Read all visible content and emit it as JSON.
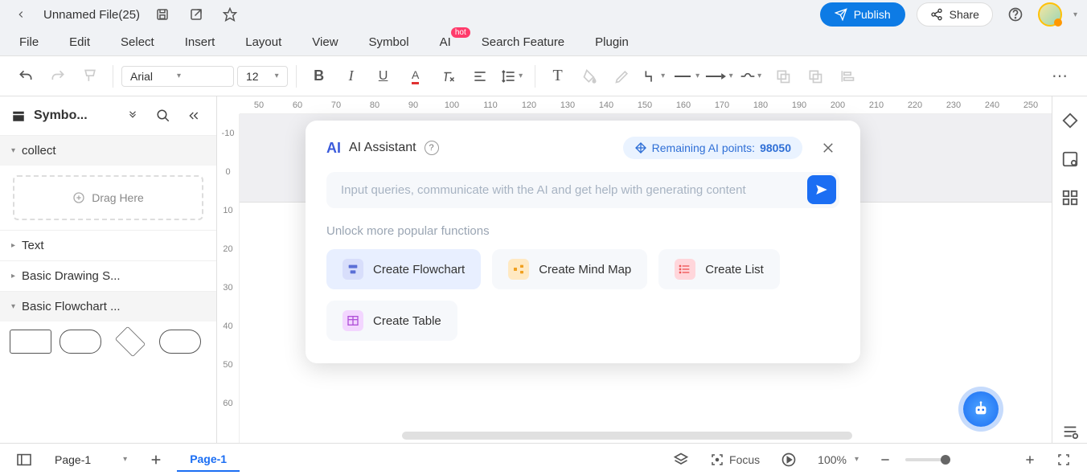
{
  "titlebar": {
    "filename": "Unnamed File(25)",
    "publish": "Publish",
    "share": "Share"
  },
  "menu": {
    "items": [
      "File",
      "Edit",
      "Select",
      "Insert",
      "Layout",
      "View",
      "Symbol",
      "AI",
      "Search Feature",
      "Plugin"
    ],
    "hot_on": "AI",
    "hot_label": "hot"
  },
  "toolbar": {
    "font": "Arial",
    "font_size": "12"
  },
  "sidebar": {
    "title": "Symbo...",
    "sections": {
      "collect": "collect",
      "drag_here": "Drag Here",
      "text": "Text",
      "basic_drawing": "Basic Drawing S...",
      "basic_flowchart": "Basic Flowchart ..."
    }
  },
  "ruler_h": [
    "50",
    "60",
    "70",
    "80",
    "90",
    "100",
    "110",
    "120",
    "130",
    "140",
    "150",
    "160",
    "170",
    "180",
    "190",
    "200",
    "210",
    "220",
    "230",
    "240",
    "250"
  ],
  "ruler_v": [
    "-10",
    "0",
    "10",
    "20",
    "30",
    "40",
    "50",
    "60"
  ],
  "ai": {
    "title": "AI Assistant",
    "points_label": "Remaining AI points:",
    "points_value": "98050",
    "input_placeholder": "Input queries, communicate with the AI and get help with generating content",
    "unlock_label": "Unlock more popular functions",
    "chips": {
      "flowchart": "Create Flowchart",
      "mindmap": "Create Mind Map",
      "list": "Create List",
      "table": "Create Table"
    }
  },
  "bottom": {
    "page_dd": "Page-1",
    "page_tab": "Page-1",
    "focus": "Focus",
    "zoom": "100%"
  }
}
